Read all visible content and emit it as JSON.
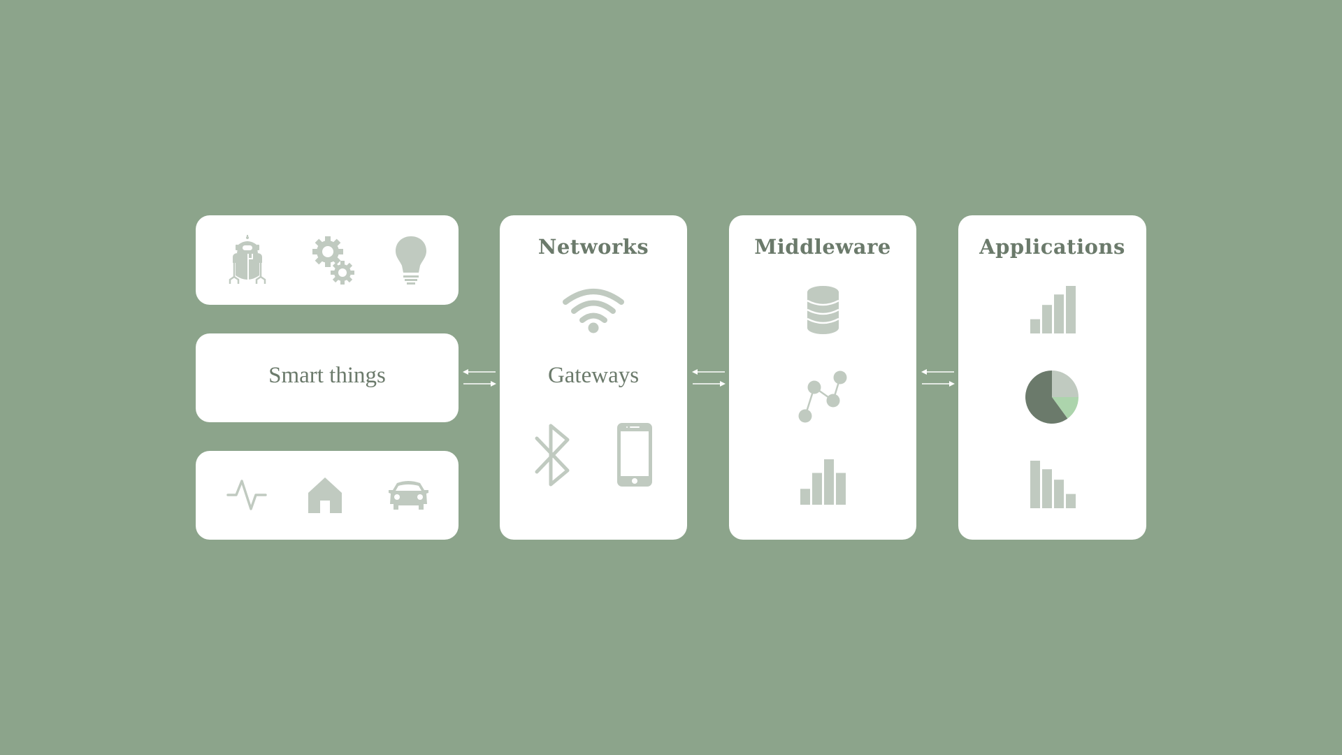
{
  "colors": {
    "background": "#8ca48b",
    "card": "#ffffff",
    "text": "#6b7a6b",
    "icon": "#c0cac0",
    "pie_dark": "#6b7a6b",
    "pie_light": "#c0cac0",
    "pie_green": "#acd4ac",
    "arrow": "#ffffff"
  },
  "smart_things": {
    "label": "Smart things",
    "top_icons": [
      "robot-icon",
      "gears-icon",
      "lightbulb-icon"
    ],
    "bottom_icons": [
      "pulse-icon",
      "home-icon",
      "car-icon"
    ]
  },
  "networks": {
    "title": "Networks",
    "label": "Gateways",
    "icons": [
      "wifi-icon",
      "bluetooth-icon",
      "smartphone-icon"
    ]
  },
  "middleware": {
    "title": "Middleware",
    "icons": [
      "database-icon",
      "scatter-line-icon",
      "bar-chart-icon"
    ]
  },
  "applications": {
    "title": "Applications",
    "icons": [
      "ascending-bar-chart-icon",
      "pie-chart-icon",
      "descending-bar-chart-icon"
    ],
    "pie_slices": [
      {
        "name": "light",
        "fraction": 0.25
      },
      {
        "name": "green",
        "fraction": 0.15
      },
      {
        "name": "dark",
        "fraction": 0.6
      }
    ],
    "ascending_bars": [
      0.3,
      0.6,
      0.82,
      1.0
    ],
    "descending_bars": [
      1.0,
      0.82,
      0.6,
      0.3
    ]
  },
  "middleware_bars": [
    0.35,
    0.7,
    1.0,
    0.7
  ],
  "connectors": [
    "bidirectional-arrow",
    "bidirectional-arrow",
    "bidirectional-arrow"
  ]
}
